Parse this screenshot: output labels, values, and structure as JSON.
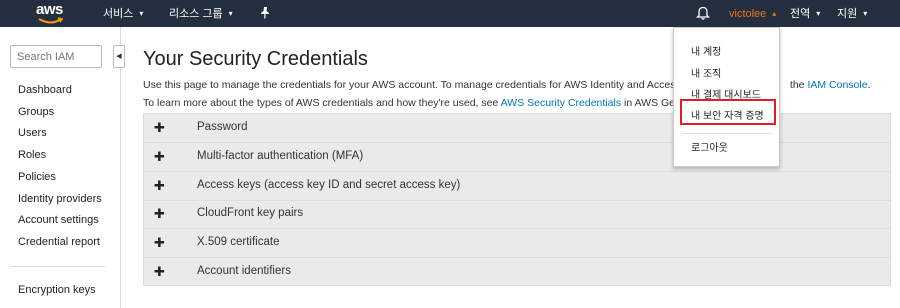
{
  "topnav": {
    "logo": "aws",
    "services": "서비스",
    "resource_groups": "리소스 그룹",
    "pin_icon": "pin-icon",
    "bell_icon": "bell-icon",
    "user": "victolee",
    "region": "전역",
    "support": "지원"
  },
  "sidebar": {
    "search_placeholder": "Search IAM",
    "items": [
      {
        "label": "Dashboard"
      },
      {
        "label": "Groups"
      },
      {
        "label": "Users"
      },
      {
        "label": "Roles"
      },
      {
        "label": "Policies"
      },
      {
        "label": "Identity providers"
      },
      {
        "label": "Account settings"
      },
      {
        "label": "Credential report"
      }
    ],
    "bottom_item": "Encryption keys"
  },
  "main": {
    "title": "Your Security Credentials",
    "intro_line1_prefix": "Use this page to manage the credentials for your AWS account. To manage credentials for AWS Identity and Access Mana",
    "intro_line1_suffix": "the",
    "iam_console_link": "IAM Console",
    "intro_line1_end": ".",
    "intro_line2_prefix": "To learn more about the types of AWS credentials and how they're used, see",
    "security_credentials_link": "AWS Security Credentials",
    "intro_line2_suffix": "in AWS General R",
    "sections": [
      {
        "label": "Password"
      },
      {
        "label": "Multi-factor authentication (MFA)"
      },
      {
        "label": "Access keys (access key ID and secret access key)"
      },
      {
        "label": "CloudFront key pairs"
      },
      {
        "label": "X.509 certificate"
      },
      {
        "label": "Account identifiers"
      }
    ],
    "expand_symbol": "✚"
  },
  "user_dropdown": {
    "items": [
      {
        "label": "내 계정"
      },
      {
        "label": "내 조직"
      },
      {
        "label": "내 결제 대시보드"
      },
      {
        "label": "내 보안 자격 증명"
      }
    ],
    "logout": "로그아웃"
  },
  "colors": {
    "nav_bg": "#232f3e",
    "user_accent": "#ec7211",
    "link": "#0073bb",
    "highlight": "#d9202a",
    "accordion_bg": "#eaeaea"
  }
}
